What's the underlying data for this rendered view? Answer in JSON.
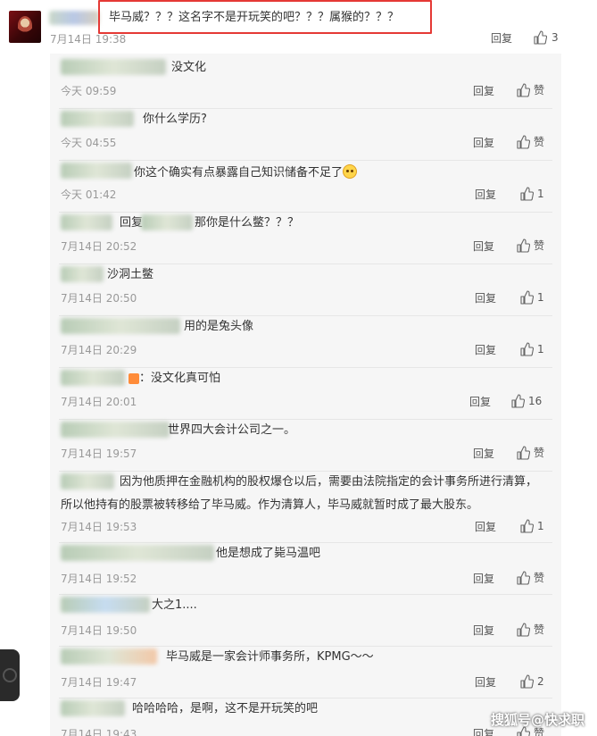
{
  "main_comment": {
    "text": "毕马威？？？这名字不是开玩笑的吧？？？属猴的？？？",
    "time": "7月14日 19:38",
    "reply_label": "回复",
    "like_count": "3"
  },
  "replies": [
    {
      "text": "没文化",
      "time": "今天 09:59",
      "reply_label": "回复",
      "like": "赞"
    },
    {
      "text": "你什么学历?",
      "time": "今天 04:55",
      "reply_label": "回复",
      "like": "赞"
    },
    {
      "text": "你这个确实有点暴露自己知识储备不足了",
      "time": "今天 01:42",
      "reply_label": "回复",
      "like": "1"
    },
    {
      "prefix": "回复",
      "text": "那你是什么鳖？？？",
      "time": "7月14日 20:52",
      "reply_label": "回复",
      "like": "赞"
    },
    {
      "text": "沙洞土鳖",
      "time": "7月14日 20:50",
      "reply_label": "回复",
      "like": "1"
    },
    {
      "text": "用的是兔头像",
      "time": "7月14日 20:29",
      "reply_label": "回复",
      "like": "1"
    },
    {
      "text": "：没文化真可怕",
      "time": "7月14日 20:01",
      "reply_label": "回复",
      "like": "16"
    },
    {
      "text": "世界四大会计公司之一。",
      "time": "7月14日 19:57",
      "reply_label": "回复",
      "like": "赞"
    },
    {
      "text": "因为他质押在金融机构的股权爆仓以后，需要由法院指定的会计事务所进行清算，",
      "text2": "所以他持有的股票被转移给了毕马威。作为清算人，毕马威就暂时成了最大股东。",
      "time": "7月14日 19:53",
      "reply_label": "回复",
      "like": "1"
    },
    {
      "text": "他是想成了毙马温吧",
      "time": "7月14日 19:52",
      "reply_label": "回复",
      "like": "赞"
    },
    {
      "text": "大之1....",
      "time": "7月14日 19:50",
      "reply_label": "回复",
      "like": "赞"
    },
    {
      "text": "毕马威是一家会计师事务所，KPMG～～",
      "time": "7月14日 19:47",
      "reply_label": "回复",
      "like": "2"
    },
    {
      "text": "哈哈哈哈，是啊，这不是开玩笑的吧",
      "time": "7月14日 19:43",
      "reply_label": "回复",
      "like": "赞"
    }
  ],
  "watermark": "搜狐号@快求职",
  "icons": {
    "like": "thumb-up-icon",
    "emoji": "smiley-face-icon",
    "side_button": "circle-button-icon"
  },
  "colors": {
    "highlight_border": "#e53935",
    "reply_bg": "#f6f6f6",
    "time_text": "#999999"
  }
}
